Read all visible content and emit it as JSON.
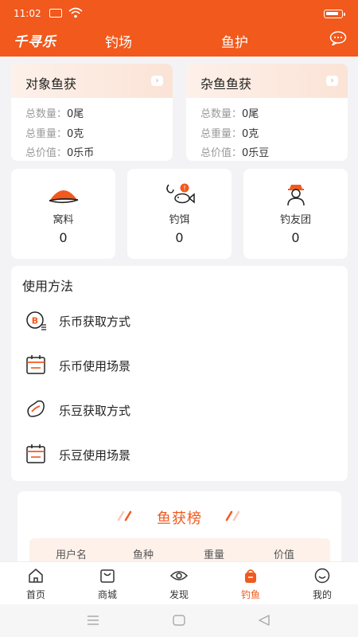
{
  "status": {
    "time": "11:02"
  },
  "nav": {
    "brand": "千寻乐",
    "tab_spots": "钓场",
    "tab_protect": "鱼护"
  },
  "target_catch": {
    "title": "对象鱼获",
    "rows": [
      {
        "label": "总数量：",
        "value": "0尾"
      },
      {
        "label": "总重量：",
        "value": "0克"
      },
      {
        "label": "总价值：",
        "value": "0乐币"
      }
    ]
  },
  "misc_catch": {
    "title": "杂鱼鱼获",
    "rows": [
      {
        "label": "总数量：",
        "value": "0尾"
      },
      {
        "label": "总重量：",
        "value": "0克"
      },
      {
        "label": "总价值：",
        "value": "0乐豆"
      }
    ]
  },
  "stats": [
    {
      "label": "窝料",
      "value": "0",
      "icon": "bait-pile-icon"
    },
    {
      "label": "钓饵",
      "value": "0",
      "icon": "hook-fish-icon"
    },
    {
      "label": "钓友团",
      "value": "0",
      "icon": "angler-group-icon"
    }
  ],
  "usage": {
    "title": "使用方法",
    "items": [
      {
        "label": "乐币获取方式",
        "icon": "coin-icon"
      },
      {
        "label": "乐币使用场景",
        "icon": "calendar-icon"
      },
      {
        "label": "乐豆获取方式",
        "icon": "bean-icon"
      },
      {
        "label": "乐豆使用场景",
        "icon": "calendar-icon"
      }
    ]
  },
  "ranking": {
    "title": "鱼获榜",
    "columns": [
      "用户名",
      "鱼种",
      "重量",
      "价值"
    ]
  },
  "tabbar": [
    {
      "label": "首页",
      "icon": "home-icon"
    },
    {
      "label": "商城",
      "icon": "shop-bag-icon"
    },
    {
      "label": "发现",
      "icon": "eye-icon"
    },
    {
      "label": "钓鱼",
      "icon": "fishing-bag-icon",
      "active": true
    },
    {
      "label": "我的",
      "icon": "smile-face-icon"
    }
  ],
  "colors": {
    "accent": "#f2591c",
    "background": "#f3f3f5",
    "card": "#ffffff"
  }
}
